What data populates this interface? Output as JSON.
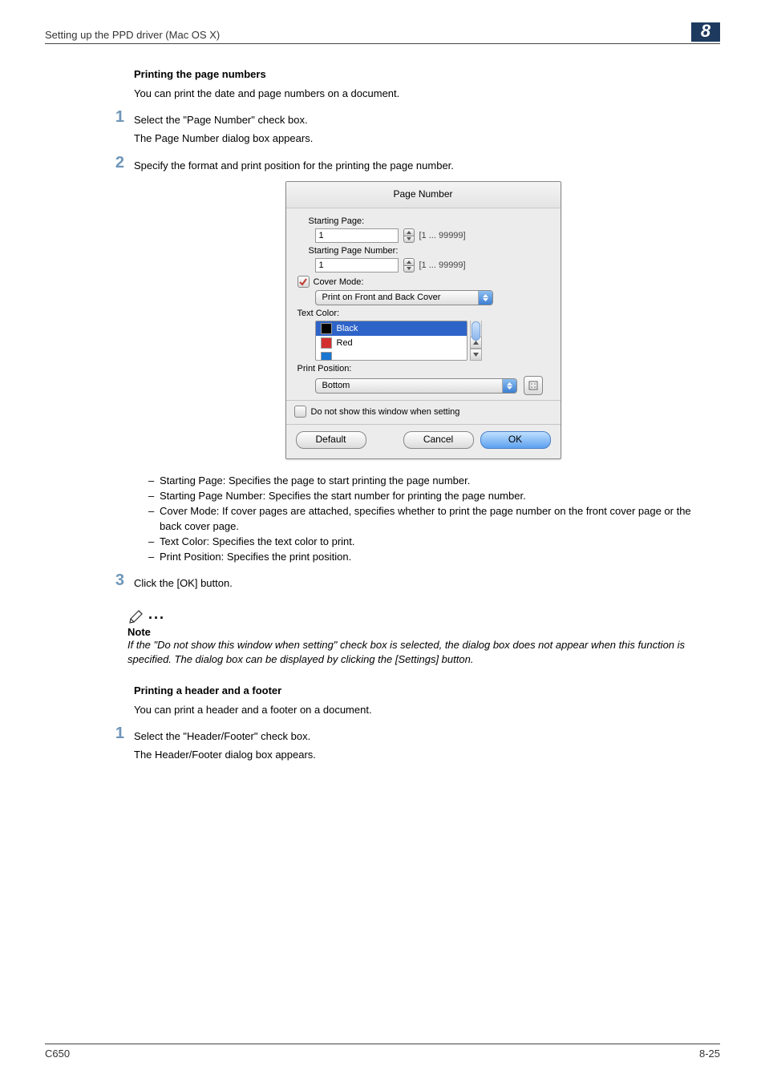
{
  "header": {
    "breadcrumb": "Setting up the PPD driver (Mac OS X)",
    "chapter": "8"
  },
  "sections": {
    "pagenum": {
      "title": "Printing the page numbers",
      "intro": "You can print the date and page numbers on a document.",
      "step1_a": "Select the \"Page Number\" check box.",
      "step1_b": "The Page Number dialog box appears.",
      "step2": "Specify the format and print position for the printing the page number.",
      "bullets": [
        "Starting Page: Specifies the page to start printing the page number.",
        "Starting Page Number: Specifies the start number for printing the page number.",
        "Cover Mode: If cover pages are attached, specifies whether to print the page number on the front cover page or the back cover page.",
        "Text Color: Specifies the text color to print.",
        "Print Position: Specifies the print position."
      ],
      "step3": "Click the [OK] button."
    },
    "note": {
      "label": "Note",
      "body": "If the \"Do not show this window when setting\" check box is selected, the dialog box does not appear when this function is specified. The dialog box can be displayed by clicking the [Settings] button."
    },
    "headerfooter": {
      "title": "Printing a header and a footer",
      "intro": "You can print a header and a footer on a document.",
      "step1_a": "Select the \"Header/Footer\" check box.",
      "step1_b": "The Header/Footer dialog box appears."
    }
  },
  "dialog": {
    "title": "Page Number",
    "starting_page_label": "Starting Page:",
    "starting_page_value": "1",
    "starting_page_hint": "[1 ... 99999]",
    "starting_num_label": "Starting Page Number:",
    "starting_num_value": "1",
    "starting_num_hint": "[1 ... 99999]",
    "cover_mode_label": "Cover Mode:",
    "cover_mode_value": "Print on Front and Back Cover",
    "text_color_label": "Text Color:",
    "colors": {
      "black": "Black",
      "red": "Red"
    },
    "print_position_label": "Print Position:",
    "print_position_value": "Bottom",
    "donot_label": "Do not show this window when setting",
    "buttons": {
      "default": "Default",
      "cancel": "Cancel",
      "ok": "OK"
    }
  },
  "footer": {
    "left": "C650",
    "right": "8-25"
  },
  "step_numbers": {
    "s1": "1",
    "s2": "2",
    "s3": "3"
  }
}
